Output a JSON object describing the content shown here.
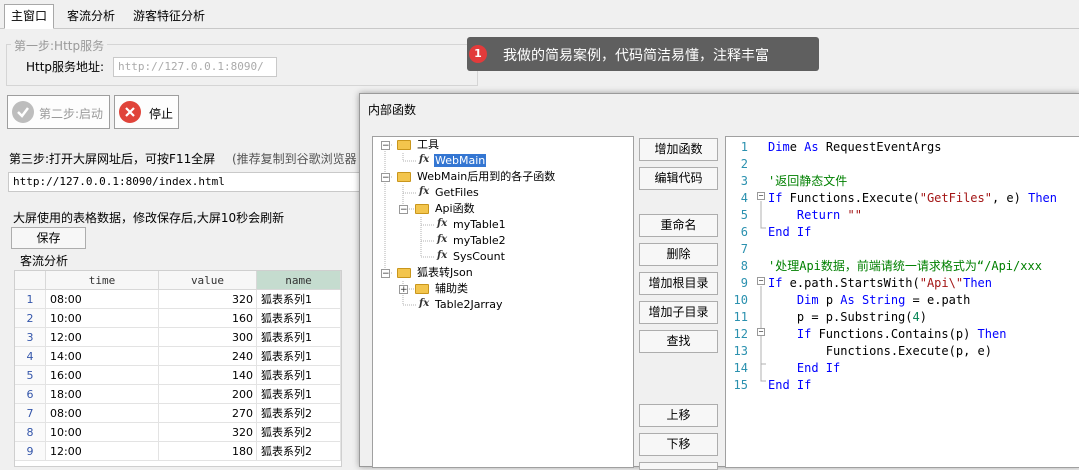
{
  "tabs": [
    "主窗口",
    "客流分析",
    "游客特征分析"
  ],
  "step1": {
    "title": "第一步:Http服务",
    "addr_label": "Http服务地址:",
    "addr_value": "http://127.0.0.1:8090/"
  },
  "step2": {
    "start_label": "第二步:启动",
    "stop_label": "停止"
  },
  "step3": {
    "label": "第三步:打开大屏网址后，可按F11全屏",
    "hint": "(推荐复制到谷歌浏览器",
    "url": "http://127.0.0.1:8090/index.html"
  },
  "table_section": {
    "title": "大屏使用的表格数据，修改保存后,大屏10秒会刷新",
    "save_label": "保存",
    "sub_title": "客流分析",
    "columns": [
      "time",
      "value",
      "name"
    ],
    "rows": [
      {
        "n": "1",
        "time": "08:00",
        "value": "320",
        "name": "狐表系列1"
      },
      {
        "n": "2",
        "time": "10:00",
        "value": "160",
        "name": "狐表系列1"
      },
      {
        "n": "3",
        "time": "12:00",
        "value": "300",
        "name": "狐表系列1"
      },
      {
        "n": "4",
        "time": "14:00",
        "value": "240",
        "name": "狐表系列1"
      },
      {
        "n": "5",
        "time": "16:00",
        "value": "140",
        "name": "狐表系列1"
      },
      {
        "n": "6",
        "time": "18:00",
        "value": "200",
        "name": "狐表系列1"
      },
      {
        "n": "7",
        "time": "08:00",
        "value": "270",
        "name": "狐表系列2"
      },
      {
        "n": "8",
        "time": "10:00",
        "value": "320",
        "name": "狐表系列2"
      },
      {
        "n": "9",
        "time": "12:00",
        "value": "180",
        "name": "狐表系列2"
      }
    ]
  },
  "tooltip": {
    "badge": "1",
    "text": "我做的简易案例，代码简洁易懂，注释丰富"
  },
  "dialog": {
    "title": "内部函数",
    "tree": {
      "tools": "工具",
      "webmain": "WebMain",
      "webmain_funcs": "WebMain后用到的各子函数",
      "getfiles": "GetFiles",
      "api_funcs": "Api函数",
      "mytable1": "myTable1",
      "mytable2": "myTable2",
      "syscount": "SysCount",
      "fox_json": "狐表转Json",
      "helpers": "辅助类",
      "table2jarray": "Table2Jarray"
    },
    "buttons": {
      "add_func": "增加函数",
      "edit_code": "编辑代码",
      "rename": "重命名",
      "delete": "删除",
      "add_root": "增加根目录",
      "add_sub": "增加子目录",
      "find": "查找",
      "move_up": "上移",
      "move_down": "下移"
    },
    "code_lines": [
      {
        "n": "1",
        "parts": [
          [
            "kw",
            "Dim"
          ],
          [
            "",
            "e "
          ],
          [
            "kw",
            "As"
          ],
          [
            "",
            " RequestEventArgs"
          ]
        ]
      },
      {
        "n": "2",
        "parts": []
      },
      {
        "n": "3",
        "parts": [
          [
            "cm",
            "'返回静态文件"
          ]
        ]
      },
      {
        "n": "4",
        "parts": [
          [
            "kw",
            "If"
          ],
          [
            "",
            " Functions.Execute("
          ],
          [
            "str",
            "\"GetFiles\""
          ],
          [
            "",
            ", e) "
          ],
          [
            "kw",
            "Then"
          ]
        ]
      },
      {
        "n": "5",
        "parts": [
          [
            "",
            "    "
          ],
          [
            "kw",
            "Return"
          ],
          [
            " str",
            " \"\""
          ]
        ]
      },
      {
        "n": "6",
        "parts": [
          [
            "kw",
            "End If"
          ]
        ]
      },
      {
        "n": "7",
        "parts": []
      },
      {
        "n": "8",
        "parts": [
          [
            "cm",
            "'处理Api数据，前端请统一请求格式为“/Api/xxx"
          ]
        ]
      },
      {
        "n": "9",
        "parts": [
          [
            "kw",
            "If"
          ],
          [
            "",
            " e.path.StartsWith("
          ],
          [
            "str",
            "\"Api\\\""
          ],
          [
            ") ",
            ""
          ],
          [
            "kw",
            "Then"
          ]
        ]
      },
      {
        "n": "10",
        "parts": [
          [
            "",
            "    "
          ],
          [
            "kw",
            "Dim"
          ],
          [
            "",
            " p "
          ],
          [
            "kw",
            "As"
          ],
          [
            "",
            " "
          ],
          [
            "kw",
            "String"
          ],
          [
            "",
            " = e.path"
          ]
        ]
      },
      {
        "n": "11",
        "parts": [
          [
            "",
            "    p = p.Substring("
          ],
          [
            "num",
            "4"
          ],
          [
            "",
            ")"
          ]
        ]
      },
      {
        "n": "12",
        "parts": [
          [
            "",
            "    "
          ],
          [
            "kw",
            "If"
          ],
          [
            "",
            " Functions.Contains(p) "
          ],
          [
            "kw",
            "Then"
          ]
        ]
      },
      {
        "n": "13",
        "parts": [
          [
            "",
            "        Functions.Execute(p, e)"
          ]
        ]
      },
      {
        "n": "14",
        "parts": [
          [
            "",
            "    "
          ],
          [
            "kw",
            "End If"
          ]
        ]
      },
      {
        "n": "15",
        "parts": [
          [
            "kw",
            "End If"
          ]
        ]
      }
    ]
  }
}
